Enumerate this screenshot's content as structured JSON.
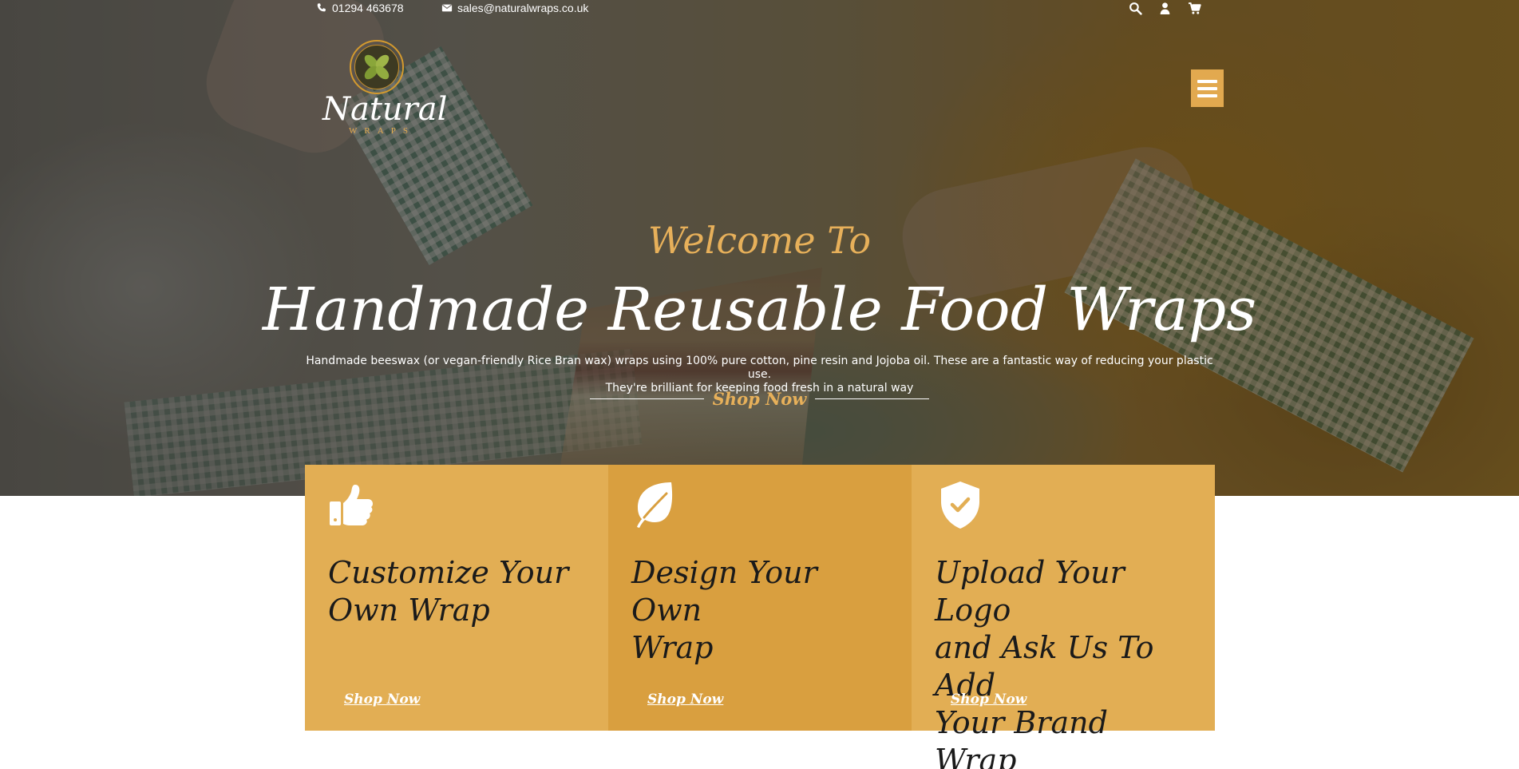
{
  "topbar": {
    "phone": "01294 463678",
    "email": "sales@naturalwraps.co.uk",
    "icons": [
      "phone-icon",
      "envelope-icon",
      "search-icon",
      "user-icon",
      "cart-icon"
    ]
  },
  "logo": {
    "word": "Natural",
    "sub": "WRAPS"
  },
  "hero": {
    "welcome": "Welcome To",
    "headline": "Handmade Reusable Food Wraps",
    "description_line1": "Handmade beeswax (or vegan-friendly Rice Bran wax) wraps using 100% pure cotton, pine resin and Jojoba oil. These are a fantastic way of reducing your plastic use.",
    "description_line2": "They're brilliant for keeping food fresh in a natural way",
    "cta": "Shop Now"
  },
  "cards": [
    {
      "icon": "thumbs-up-icon",
      "title_line1": "Customize Your",
      "title_line2": "Own Wrap",
      "title_line3": "",
      "cta": "Shop Now"
    },
    {
      "icon": "leaf-icon",
      "title_line1": "Design Your Own",
      "title_line2": "Wrap",
      "title_line3": "",
      "cta": "Shop Now"
    },
    {
      "icon": "shield-check-icon",
      "title_line1": "Upload Your Logo",
      "title_line2": "and Ask Us To Add",
      "title_line3": "Your Brand Wrap",
      "cta": "Shop Now"
    }
  ],
  "colors": {
    "accent": "#e2a94f",
    "card_light": "#e2ae54",
    "card_dark": "#d99f3f",
    "welcome_gold": "#e7b05a"
  }
}
